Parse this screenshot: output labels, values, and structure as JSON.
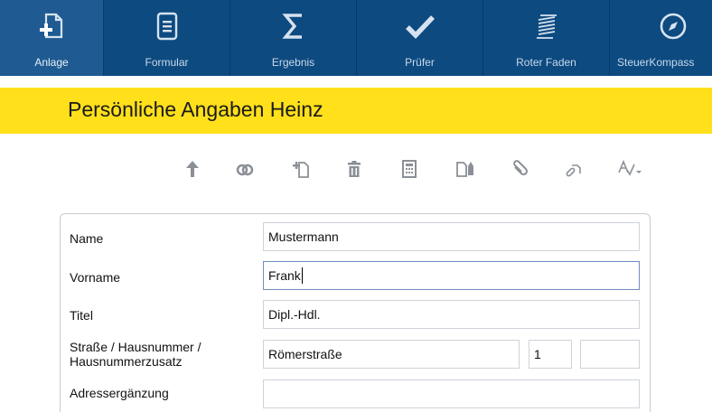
{
  "nav": {
    "items": [
      {
        "label": "Anlage",
        "icon": "new-document-plus-icon",
        "active": true
      },
      {
        "label": "Formular",
        "icon": "form-document-icon",
        "active": false
      },
      {
        "label": "Ergebnis",
        "icon": "sigma-icon",
        "active": false
      },
      {
        "label": "Prüfer",
        "icon": "checkmark-icon",
        "active": false
      },
      {
        "label": "Roter Faden",
        "icon": "thread-lines-icon",
        "active": false
      },
      {
        "label": "SteuerKompass",
        "icon": "compass-icon",
        "active": false
      }
    ]
  },
  "header": {
    "title": "Persönliche Angaben Heinz"
  },
  "toolbar": {
    "items": [
      "arrow-up-icon",
      "link-rings-icon",
      "add-page-icon",
      "trash-icon",
      "calculator-icon",
      "document-pen-icon",
      "paperclip-icon",
      "attach-link-icon",
      "spellcheck-icon"
    ]
  },
  "form": {
    "name": {
      "label": "Name",
      "value": "Mustermann"
    },
    "vorname": {
      "label": "Vorname",
      "value": "Frank"
    },
    "titel": {
      "label": "Titel",
      "value": "Dipl.-Hdl."
    },
    "strasse": {
      "label_line1": "Straße / Hausnummer /",
      "label_line2": "Hausnummerzusatz",
      "street": "Römerstraße",
      "number": "1",
      "suffix": ""
    },
    "adresse": {
      "label": "Adressergänzung",
      "value": ""
    }
  },
  "colors": {
    "nav_bg": "#0d4a80",
    "nav_active": "#1f5b92",
    "header_yellow": "#ffe01b",
    "focus_border": "#6d8fbf"
  }
}
